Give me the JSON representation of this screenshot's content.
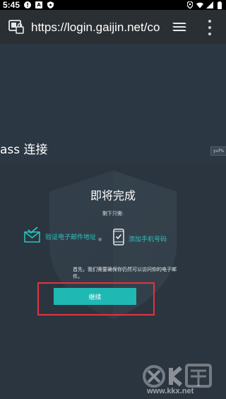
{
  "status_bar": {
    "time": "5:45",
    "icons": [
      "alert-icon",
      "a-icon",
      "shield-small-icon",
      "location-icon",
      "wifi-icon",
      "signal-icon",
      "battery-icon"
    ]
  },
  "browser": {
    "url": "https://login.gaijin.net/co",
    "icons": [
      "site-info-icon",
      "tabs-icon",
      "overflow-menu-icon"
    ]
  },
  "page": {
    "partial_title": "ass 连接",
    "language_box": "yuf%"
  },
  "dialog": {
    "heading": "即将完成",
    "subtext": "剩下只需:",
    "step_email": "验证电子邮件地址",
    "step_phone": "添加手机号码",
    "notice": "首先，我们需要确保你仍然可以访问你的电子邮件。",
    "continue_label": "继续"
  },
  "watermark": {
    "url": "www.kkx.net"
  },
  "colors": {
    "accent": "#1fb8b2",
    "highlight": "#e0353d",
    "background": "#2b3540"
  }
}
